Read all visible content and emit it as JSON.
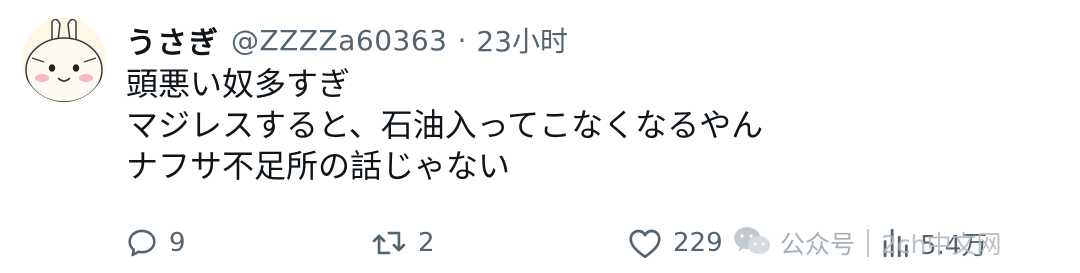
{
  "tweet": {
    "display_name": "うさぎ",
    "handle": "@ZZZZa60363",
    "separator": "·",
    "time": "23小时",
    "lines": [
      "頭悪い奴多すぎ",
      "マジレスすると、石油入ってこなくなるやん",
      "ナフサ不足所の話じゃない"
    ]
  },
  "actions": {
    "reply_count": "9",
    "retweet_count": "2",
    "like_count": "229",
    "views_count": "5.4万"
  },
  "watermark": {
    "account_label": "公众号",
    "site": "2ch中文网"
  },
  "colors": {
    "text": "#0f1419",
    "muted": "#536471",
    "avatar_bg": "#fff7e6",
    "avatar_blush": "#f6b8c4"
  },
  "icons": {
    "reply": "speech-bubble-icon",
    "retweet": "retweet-icon",
    "like": "heart-icon",
    "views": "bar-chart-icon",
    "watermark": "wechat-icon"
  }
}
